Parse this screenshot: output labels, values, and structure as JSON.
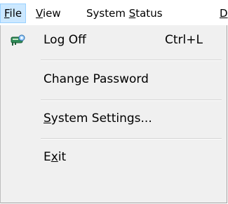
{
  "menubar": {
    "file": {
      "before": "",
      "mnemonic": "F",
      "after": "ile"
    },
    "view": {
      "before": "",
      "mnemonic": "V",
      "after": "iew"
    },
    "system_status": {
      "before": "System ",
      "mnemonic": "S",
      "after": "tatus"
    },
    "next": {
      "mnemonic": "D"
    }
  },
  "file_menu": {
    "log_off": {
      "label": "Log Off",
      "shortcut": "Ctrl+L",
      "icon": "log-off-icon"
    },
    "change_password": {
      "label": "Change Password"
    },
    "system_settings": {
      "mnemonic": "S",
      "rest": "ystem Settings..."
    },
    "exit": {
      "before": "E",
      "mnemonic": "x",
      "after": "it"
    }
  },
  "colors": {
    "highlight": "#cce8ff",
    "highlight_border": "#99d1ff",
    "menu_bg": "#f0f0f0"
  }
}
